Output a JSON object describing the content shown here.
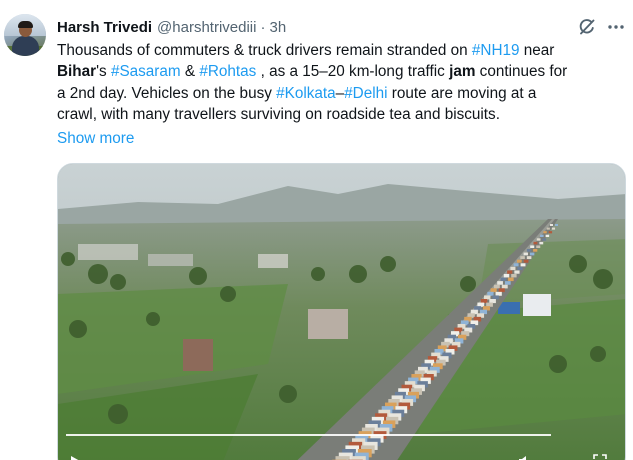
{
  "tweet": {
    "author_name": "Harsh Trivedi",
    "handle": "@harshtrivediii",
    "separator": "·",
    "time": "3h",
    "text_lines": [
      [
        {
          "t": "Thousands of commuters & truck drivers remain stranded on ",
          "k": "plain"
        },
        {
          "t": "#NH19",
          "k": "tag"
        },
        {
          "t": " near",
          "k": "plain"
        }
      ],
      [
        {
          "t": "Bihar",
          "k": "bold"
        },
        {
          "t": "'s ",
          "k": "plain"
        },
        {
          "t": "#Sasaram",
          "k": "tag"
        },
        {
          "t": " & ",
          "k": "plain"
        },
        {
          "t": "#Rohtas",
          "k": "tag"
        },
        {
          "t": " , as a 15–20 km-long traffic ",
          "k": "plain"
        },
        {
          "t": "jam",
          "k": "bold"
        },
        {
          "t": " continues for",
          "k": "plain"
        }
      ],
      [
        {
          "t": "a 2nd day. Vehicles on the busy ",
          "k": "plain"
        },
        {
          "t": "#Kolkata",
          "k": "tag"
        },
        {
          "t": "–",
          "k": "plain"
        },
        {
          "t": "#Delhi",
          "k": "tag"
        },
        {
          "t": " route are moving at a",
          "k": "plain"
        }
      ],
      [
        {
          "t": "crawl, with many travellers surviving on roadside tea and biscuits.",
          "k": "plain"
        }
      ]
    ],
    "show_more": "Show more"
  },
  "icons": {
    "grok": "grok-icon",
    "more": "more-options-icon",
    "play": "play-icon",
    "volume": "volume-icon",
    "fullscreen": "fullscreen-icon"
  },
  "media": {
    "kind": "video",
    "description_icon": "aerial-highway-traffic-jam"
  },
  "colors": {
    "link": "#1d9bf0",
    "text": "#0f1419",
    "secondary": "#536471",
    "border": "#cfd9de"
  }
}
